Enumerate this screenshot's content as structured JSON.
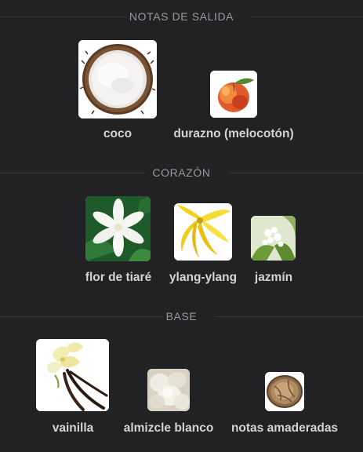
{
  "sections": [
    {
      "title": "NOTAS DE SALIDA",
      "notes": [
        {
          "name": "coco",
          "icon": "coconut-image"
        },
        {
          "name": "durazno (melocotón)",
          "icon": "peach-image"
        }
      ]
    },
    {
      "title": "CORAZÓN",
      "notes": [
        {
          "name": "flor de tiaré",
          "icon": "tiare-flower-image"
        },
        {
          "name": "ylang-ylang",
          "icon": "ylang-ylang-image"
        },
        {
          "name": "jazmín",
          "icon": "jasmine-image"
        }
      ]
    },
    {
      "title": "BASE",
      "notes": [
        {
          "name": "vainilla",
          "icon": "vanilla-image"
        },
        {
          "name": "almizcle blanco",
          "icon": "white-musk-image"
        },
        {
          "name": "notas amaderadas",
          "icon": "woody-notes-image"
        }
      ]
    }
  ],
  "colors": {
    "background": "#222124",
    "divider": "#37363a",
    "section_title": "#9a9a9e",
    "note_label": "#d4d4d4"
  }
}
